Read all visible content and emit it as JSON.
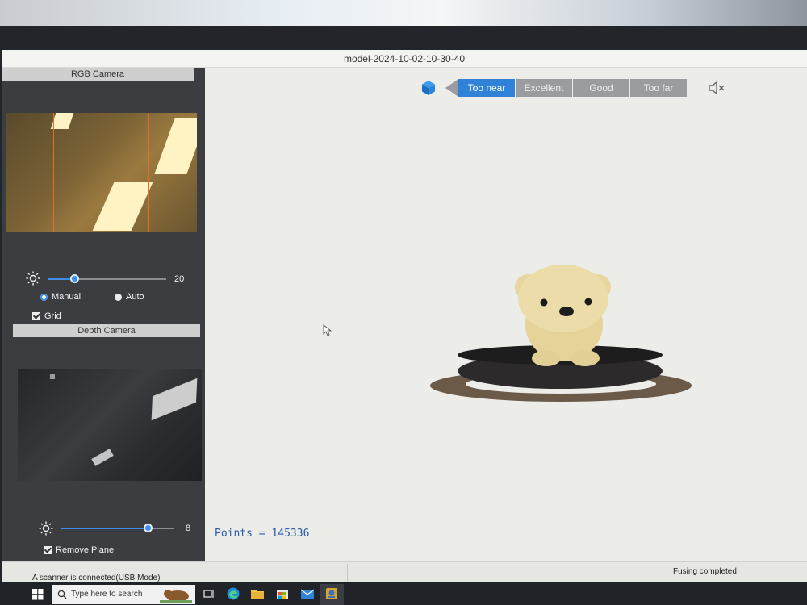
{
  "window": {
    "title": "model-2024-10-02-10-30-40"
  },
  "left_panel": {
    "rgb_camera": {
      "header": "RGB Camera",
      "brightness_value": "20",
      "brightness_level": 0.22,
      "mode_manual_label": "Manual",
      "mode_auto_label": "Auto",
      "selected_mode": "Manual",
      "grid_label": "Grid",
      "grid_checked": true
    },
    "depth_camera": {
      "header": "Depth Camera",
      "brightness_value": "8",
      "brightness_level": 0.77,
      "remove_plane_label": "Remove Plane",
      "remove_plane_checked": true
    }
  },
  "toolbar": {
    "cube_icon": "cube-view-icon",
    "distance_options": [
      "Too near",
      "Excellent",
      "Good",
      "Too far"
    ],
    "selected_distance": "Too near",
    "mute_icon": "speaker-muted-icon"
  },
  "viewport": {
    "points_readout": "Points = 145336"
  },
  "status": {
    "connection": "A scanner is connected(USB Mode)",
    "fusing": "Fusing completed"
  },
  "taskbar": {
    "search_placeholder": "Type here to search",
    "icons": [
      "windows-start-icon",
      "search-icon",
      "task-view-icon",
      "edge-icon",
      "file-explorer-icon",
      "store-icon",
      "mail-icon",
      "scanner-app-icon"
    ]
  },
  "colors": {
    "accent": "#2f82d8",
    "panel": "#3b3d40",
    "viewport_bg": "#ecece9",
    "points_text": "#2a5aa8"
  }
}
